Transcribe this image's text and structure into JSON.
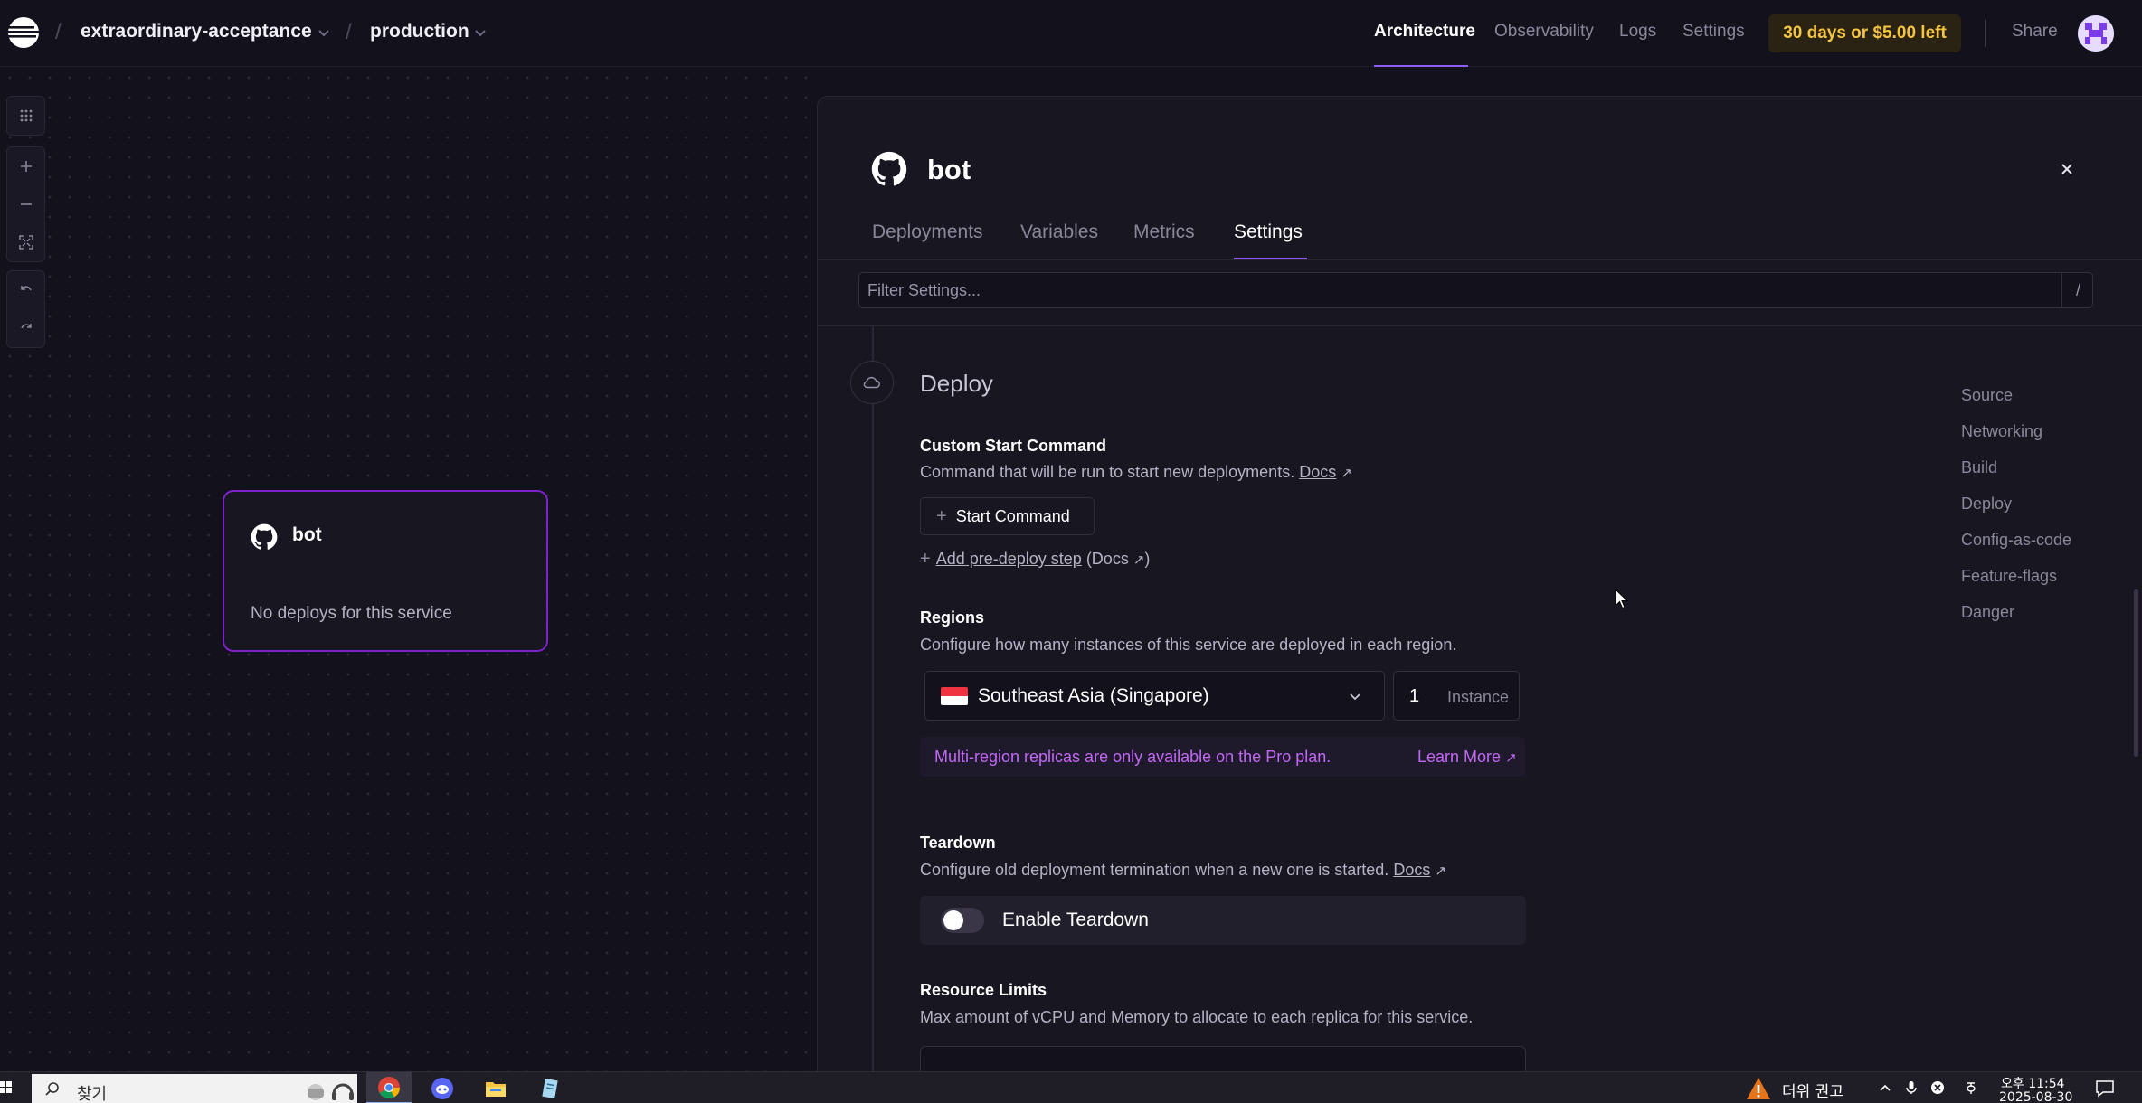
{
  "topbar": {
    "project": "extraordinary-acceptance",
    "environment": "production",
    "separator": "/",
    "nav": [
      {
        "label": "Architecture",
        "active": true
      },
      {
        "label": "Observability",
        "active": false
      },
      {
        "label": "Logs",
        "active": false
      },
      {
        "label": "Settings",
        "active": false
      }
    ],
    "trial": "30 days or $5.00 left",
    "share": "Share"
  },
  "canvas_tools": [
    "grid-icon",
    "zoom-in-icon",
    "zoom-out-icon",
    "fit-view-icon",
    "undo-icon",
    "redo-icon"
  ],
  "service_card": {
    "name": "bot",
    "status": "No deploys for this service"
  },
  "panel": {
    "title": "bot",
    "tabs": [
      {
        "label": "Deployments",
        "active": false
      },
      {
        "label": "Variables",
        "active": false
      },
      {
        "label": "Metrics",
        "active": false
      },
      {
        "label": "Settings",
        "active": true
      }
    ],
    "filter": {
      "placeholder": "Filter Settings...",
      "shortcut": "/"
    },
    "section": {
      "title": "Deploy",
      "custom_start": {
        "label": "Custom Start Command",
        "desc": "Command that will be run to start new deployments.",
        "docs": "Docs",
        "button": "Start Command",
        "predeploy_link": "Add pre-deploy step",
        "predeploy_docs": "(Docs",
        "predeploy_close": ")"
      },
      "regions": {
        "label": "Regions",
        "desc": "Configure how many instances of this service are deployed in each region.",
        "selected": "Southeast Asia (Singapore)",
        "instances": "1",
        "instance_label": "Instance",
        "notice": "Multi-region replicas are only available on the Pro plan.",
        "learn_more": "Learn More"
      },
      "teardown": {
        "label": "Teardown",
        "desc": "Configure old deployment termination when a new one is started.",
        "docs": "Docs",
        "toggle_label": "Enable Teardown",
        "enabled": false
      },
      "resource_limits": {
        "label": "Resource Limits",
        "desc": "Max amount of vCPU and Memory to allocate to each replica for this service."
      }
    },
    "toc": [
      "Source",
      "Networking",
      "Build",
      "Deploy",
      "Config-as-code",
      "Feature-flags",
      "Danger"
    ]
  },
  "taskbar": {
    "search_text": "찾기",
    "apps": [
      "chrome-icon",
      "discord-icon",
      "file-explorer-icon",
      "notepad-icon"
    ],
    "weather": "더위 권고",
    "clock_time": "오후 11:54",
    "clock_date": "2025-08-30"
  },
  "colors": {
    "accent": "#8b5cf6",
    "card_border": "#7e22ce",
    "trial_text": "#f5c542",
    "notice_text": "#c268f5",
    "background": "#13111c",
    "panel": "#181621"
  }
}
